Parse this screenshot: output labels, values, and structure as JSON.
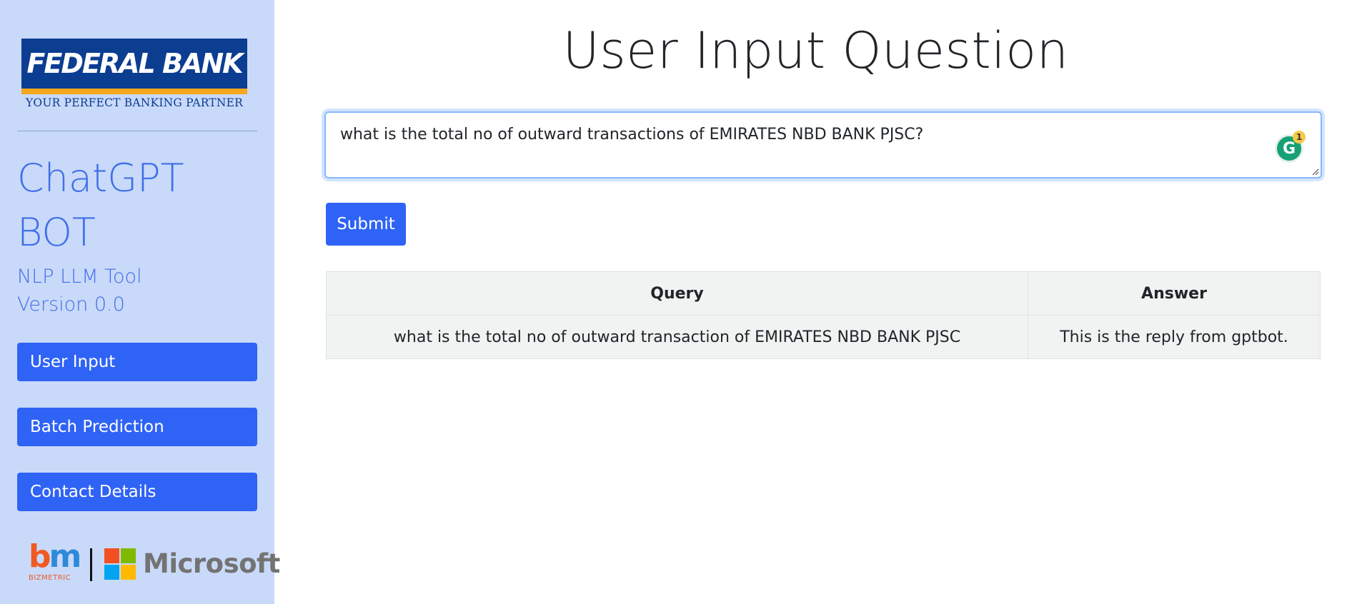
{
  "sidebar": {
    "logo": {
      "name": "FEDERAL BANK",
      "tagline": "YOUR PERFECT BANKING PARTNER"
    },
    "brand_title": "ChatGPT BOT",
    "subtitle_line1": "NLP LLM Tool",
    "subtitle_line2": "Version 0.0",
    "nav": [
      {
        "label": "User Input"
      },
      {
        "label": "Batch Prediction"
      },
      {
        "label": "Contact Details"
      }
    ],
    "partners": {
      "bizmetric_letters_b": "b",
      "bizmetric_letters_m": "m",
      "bizmetric_sub": "BIZMETRIC",
      "microsoft": "Microsoft"
    }
  },
  "main": {
    "title": "User Input Question",
    "question_value": "what is the total no of outward transactions of EMIRATES NBD BANK PJSC?",
    "grammarly_badge": "1",
    "submit_label": "Submit",
    "table": {
      "headers": [
        "Query",
        "Answer"
      ],
      "rows": [
        [
          "what is the total no of outward transaction of EMIRATES NBD BANK PJSC",
          "This is the reply from gptbot."
        ]
      ]
    }
  },
  "colors": {
    "sidebar_bg": "#c9d9f9",
    "accent": "#2f63f6",
    "brand_text": "#3f6fe8",
    "bank_blue": "#0b3d91",
    "bank_gold": "#f5a81c"
  },
  "icons": [
    "federal-bank-logo",
    "grammarly-icon",
    "resize-grip-icon",
    "bizmetric-logo",
    "microsoft-logo"
  ]
}
